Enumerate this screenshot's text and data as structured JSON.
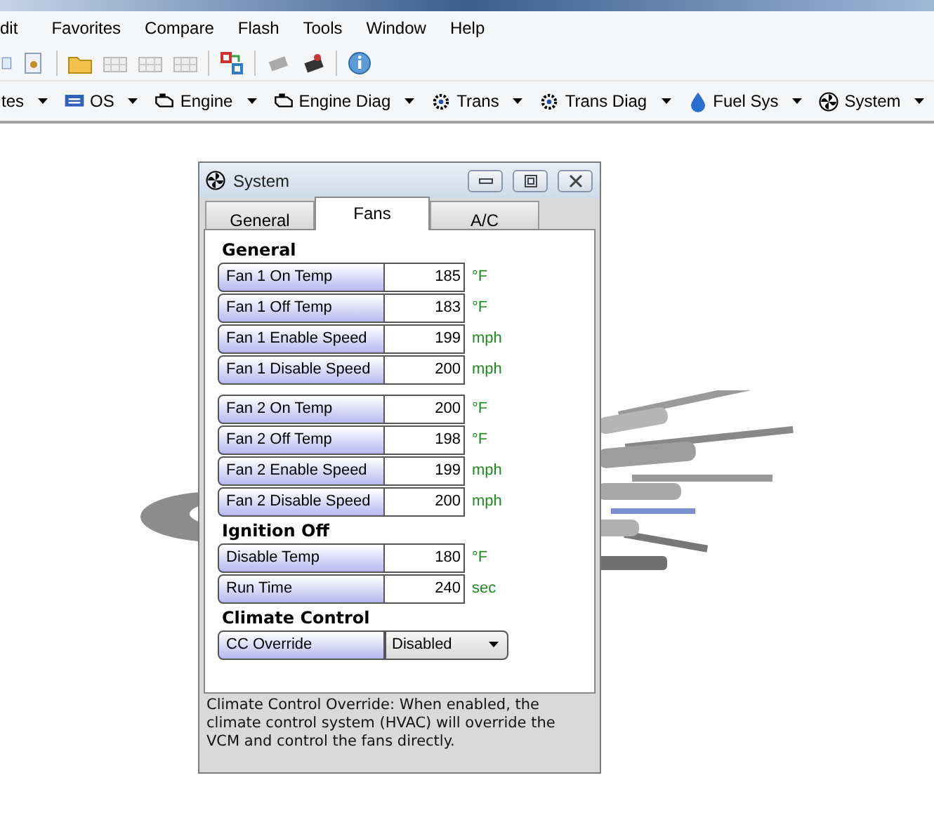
{
  "menu": [
    "dit",
    "Favorites",
    "Compare",
    "Flash",
    "Tools",
    "Window",
    "Help"
  ],
  "nav": [
    "tes",
    "OS",
    "Engine",
    "Engine Diag",
    "Trans",
    "Trans Diag",
    "Fuel Sys",
    "System"
  ],
  "dialog": {
    "title": "System",
    "tabs": [
      {
        "label": "General",
        "selected": false
      },
      {
        "label": "Fans",
        "selected": true
      },
      {
        "label": "A/C",
        "selected": false
      }
    ],
    "sections": [
      {
        "heading": "General",
        "groups": [
          [
            {
              "kind": "number",
              "label": "Fan 1 On Temp",
              "value": "185",
              "unit": "°F"
            },
            {
              "kind": "number",
              "label": "Fan 1 Off Temp",
              "value": "183",
              "unit": "°F"
            },
            {
              "kind": "number",
              "label": "Fan 1 Enable Speed",
              "value": "199",
              "unit": "mph"
            },
            {
              "kind": "number",
              "label": "Fan 1 Disable Speed",
              "value": "200",
              "unit": "mph"
            }
          ],
          [
            {
              "kind": "number",
              "label": "Fan 2 On Temp",
              "value": "200",
              "unit": "°F"
            },
            {
              "kind": "number",
              "label": "Fan 2 Off Temp",
              "value": "198",
              "unit": "°F"
            },
            {
              "kind": "number",
              "label": "Fan 2 Enable Speed",
              "value": "199",
              "unit": "mph"
            },
            {
              "kind": "number",
              "label": "Fan 2 Disable Speed",
              "value": "200",
              "unit": "mph"
            }
          ]
        ]
      },
      {
        "heading": "Ignition Off",
        "groups": [
          [
            {
              "kind": "number",
              "label": "Disable Temp",
              "value": "180",
              "unit": "°F"
            },
            {
              "kind": "number",
              "label": "Run Time",
              "value": "240",
              "unit": "sec"
            }
          ]
        ]
      },
      {
        "heading": "Climate Control",
        "groups": [
          [
            {
              "kind": "dropdown",
              "label": "CC Override",
              "value": "Disabled"
            }
          ]
        ]
      }
    ],
    "help": "Climate Control Override: When enabled, the climate control system (HVAC) will override the VCM and control the fans directly."
  }
}
